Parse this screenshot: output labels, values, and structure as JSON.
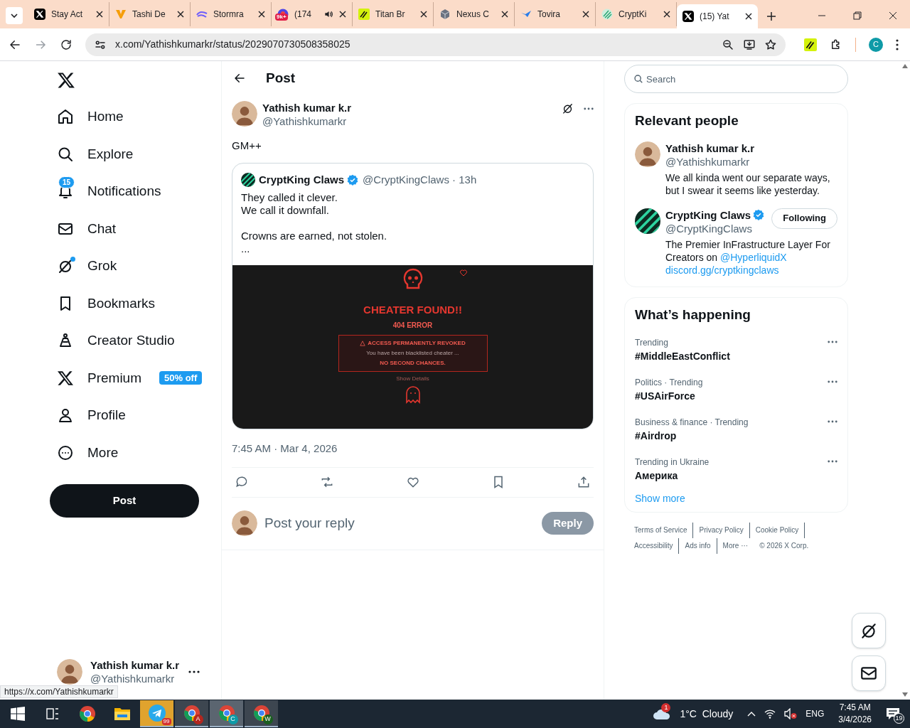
{
  "browser": {
    "tabs": [
      {
        "title": "Stay Act",
        "kind": "x",
        "selected": false
      },
      {
        "title": "Tashi De",
        "kind": "v",
        "selected": false
      },
      {
        "title": "Stormra",
        "kind": "swirl",
        "selected": false
      },
      {
        "title": "(174",
        "kind": "circle",
        "badge": "9k+",
        "audio": true,
        "selected": false
      },
      {
        "title": "Titan Br",
        "kind": "titan",
        "selected": false
      },
      {
        "title": "Nexus C",
        "kind": "cube",
        "selected": false
      },
      {
        "title": "Tovira",
        "kind": "bird",
        "selected": false
      },
      {
        "title": "CryptKi",
        "kind": "stripes",
        "selected": false
      },
      {
        "title": "(15) Yat",
        "kind": "x",
        "selected": true
      }
    ],
    "address": "x.com/Yathishkumarkr/status/2029070730508358025",
    "profile_letter": "C"
  },
  "sidebar": {
    "items": [
      {
        "label": "Home",
        "kind": "home",
        "selected": false
      },
      {
        "label": "Explore",
        "kind": "explore",
        "selected": false
      },
      {
        "label": "Notifications",
        "kind": "notifications",
        "badge": "15",
        "selected": false
      },
      {
        "label": "Chat",
        "kind": "chat",
        "selected": false
      },
      {
        "label": "Grok",
        "kind": "grok",
        "dot": true,
        "selected": false
      },
      {
        "label": "Bookmarks",
        "kind": "bookmarks",
        "selected": false
      },
      {
        "label": "Creator Studio",
        "kind": "creator",
        "selected": false
      },
      {
        "label": "Premium",
        "kind": "premium",
        "tag": "50% off",
        "selected": false
      },
      {
        "label": "Profile",
        "kind": "profile",
        "selected": false
      },
      {
        "label": "More",
        "kind": "more",
        "selected": false
      }
    ],
    "post_button": "Post",
    "account": {
      "name": "Yathish kumar k.r",
      "handle": "@Yathishkumarkr"
    }
  },
  "main": {
    "header": "Post",
    "post": {
      "name": "Yathish kumar k.r",
      "handle": "@Yathishkumarkr",
      "text": "GM++",
      "quote": {
        "name": "CryptKing Claws",
        "verified": true,
        "meta": "@CryptKingClaws · 13h",
        "paragraphs": [
          "They called it clever.\nWe call it downfall.",
          "Crowns are earned, not stolen.\n..."
        ],
        "image": {
          "title": "CHEATER FOUND!!",
          "subtitle": "404 ERROR",
          "alert_title": "ACCESS PERMANENTLY REVOKED",
          "alert_text": "You have been blacklisted cheater ...",
          "alert_footer": "NO SECOND CHANCES.",
          "details": "Show Details"
        }
      },
      "timestamp": "7:45 AM · Mar 4, 2026"
    },
    "reply": {
      "placeholder": "Post your reply",
      "button": "Reply",
      "disabled": true
    }
  },
  "right": {
    "search_placeholder": "Search",
    "relevant": {
      "title": "Relevant people",
      "people": [
        {
          "name": "Yathish kumar k.r",
          "handle": "@Yathishkumarkr",
          "verified": false,
          "bio": [
            {
              "text": "We all kinda went our separate ways, but I swear it seems like yesterday."
            }
          ]
        },
        {
          "name": "CryptKing Claws",
          "handle": "@CryptKingClaws",
          "verified": true,
          "button": "Following",
          "bio": [
            {
              "text": "The Premier InFrastructure Layer For Creators on "
            },
            {
              "text": "@HyperliquidX",
              "link": true
            },
            {
              "text": "discord.gg/cryptkingclaws",
              "link": true
            }
          ]
        }
      ]
    },
    "happening": {
      "title": "What’s happening",
      "trends": [
        {
          "context": "Trending",
          "topic": "#MiddleEastConflict"
        },
        {
          "context": "Politics · Trending",
          "topic": "#USAirForce"
        },
        {
          "context": "Business & finance · Trending",
          "topic": "#Airdrop"
        },
        {
          "context": "Trending in Ukraine",
          "topic": "Америка"
        }
      ],
      "show_more": "Show more"
    },
    "footer": {
      "links": [
        "Terms of Service",
        "Privacy Policy",
        "Cookie Policy",
        "Accessibility",
        "Ads info",
        "More ···"
      ],
      "copyright": "© 2026 X Corp."
    }
  },
  "status_url": "https://x.com/Yathishkumarkr",
  "taskbar": {
    "apps": [
      {
        "kind": "start",
        "open": false,
        "selected": false
      },
      {
        "kind": "taskview",
        "open": false,
        "selected": false
      },
      {
        "kind": "chrome",
        "open": false,
        "selected": false
      },
      {
        "kind": "explorer",
        "open": false,
        "selected": false
      },
      {
        "kind": "telegram",
        "badge": "99",
        "open": true,
        "selected": false
      },
      {
        "kind": "chrome",
        "profile": "A",
        "open": true,
        "selected": false
      },
      {
        "kind": "chrome",
        "profile": "C",
        "open": true,
        "selected": true
      },
      {
        "kind": "chrome",
        "profile": "W",
        "open": true,
        "selected": false
      }
    ],
    "weather_badge": "1",
    "weather": "1°C  Cloudy",
    "language": "ENG",
    "time": "7:45 AM",
    "date": "3/4/2026",
    "notifications": "19"
  }
}
